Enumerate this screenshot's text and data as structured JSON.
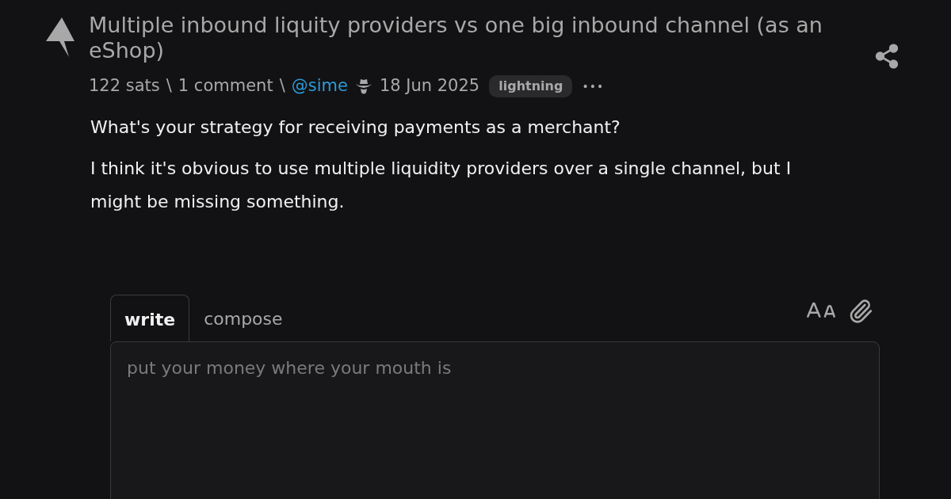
{
  "post": {
    "title": "Multiple inbound liquity providers vs one big inbound channel (as an eShop)",
    "meta": {
      "sats": "122 sats",
      "separator_1": "\\",
      "comments": "1 comment",
      "separator_2": "\\",
      "author": "@sime",
      "date": "18 Jun 2025",
      "tag": "lightning",
      "more": "•••"
    },
    "paragraphs": [
      "What's your strategy for receiving payments as a merchant?",
      "I think it's obvious to use multiple liquidity providers over a single channel, but I might be missing something."
    ]
  },
  "editor": {
    "tabs": [
      {
        "label": "write",
        "selected": true
      },
      {
        "label": "compose",
        "selected": false
      }
    ],
    "placeholder": "put your money where your mouth is"
  }
}
